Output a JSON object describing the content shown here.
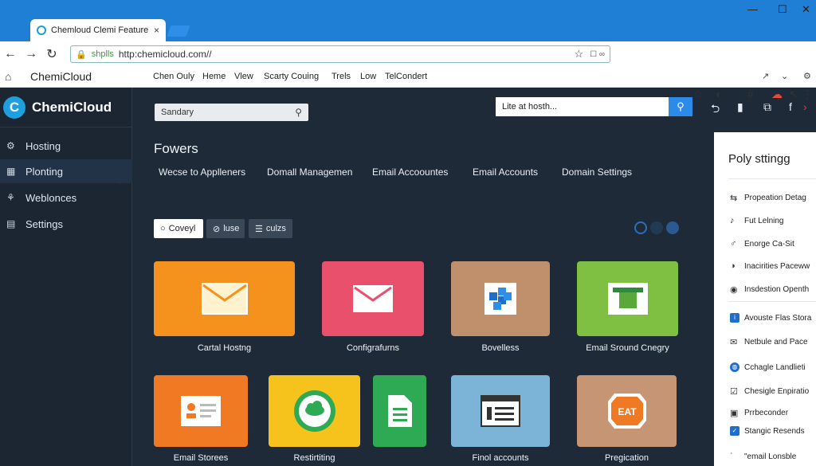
{
  "browser": {
    "tab_title": "Chemloud Clemi Feature",
    "tab_close": "×",
    "url_scheme": "shplls",
    "url": "http:chemicloud.com//",
    "url_extra": "☐ ∞"
  },
  "bookmarks": {
    "brand": "ChemiCloud",
    "items": [
      "Chen Ouly",
      "Heme",
      "Vlew",
      "Scarty Couing",
      "Trels",
      "Low",
      "TelCondert"
    ]
  },
  "sidebar": {
    "logo_letter": "C",
    "logo_text": "ChemiCloud",
    "items": [
      {
        "label": "Hosting",
        "icon": "⚙"
      },
      {
        "label": "Plonting",
        "icon": "▦"
      },
      {
        "label": "Weblonces",
        "icon": "⚘"
      },
      {
        "label": "Settings",
        "icon": "▤"
      }
    ]
  },
  "main": {
    "search_placeholder": "Sandary",
    "top_search_value": "Lite at hosth...",
    "section_title": "Fowers",
    "subtabs": [
      "Wecse to Applleners",
      "Domall Managemen",
      "Email Accoountes",
      "Email Accounts",
      "Domain Settings"
    ],
    "filters": [
      "Coveyl",
      "luse",
      "culzs"
    ],
    "cards": [
      {
        "label": "Cartal Hostng",
        "color": "#f5921e"
      },
      {
        "label": "Configrafurns",
        "color": "#e8506b"
      },
      {
        "label": "Bovelless",
        "color": "#c08f6c"
      },
      {
        "label": "Email Sround Cnegry",
        "color": "#7fbf41"
      },
      {
        "label": "Email Storees",
        "color": "#f07a24"
      },
      {
        "label": "Restirtiting",
        "color": "#f6c21c"
      },
      {
        "label": "",
        "color": "#2eaa55"
      },
      {
        "label": "Finol accounts",
        "color": "#7cb4d8"
      },
      {
        "label": "Pregication",
        "color": "#c69674"
      }
    ],
    "card_glyph_text": "EAT"
  },
  "right_panel": {
    "title": "Poly sttingg",
    "rows": [
      {
        "label": "Propeation Detag",
        "icon": "⇆"
      },
      {
        "label": "Fut Lelning",
        "icon": "♪"
      },
      {
        "label": "Enorge Ca-Sit",
        "icon": "♂"
      },
      {
        "label": "Inacirities Paceww",
        "icon": "◑"
      },
      {
        "label": "Insdestion Openth",
        "icon": "◉"
      },
      {
        "label": "Avouste Flas Stora",
        "icon": "i"
      },
      {
        "label": "Netbule and Pace",
        "icon": "✉"
      },
      {
        "label": "Cchagle Landlieti",
        "icon": "◍"
      },
      {
        "label": "Chesigle Enpiratio",
        "icon": "☑"
      },
      {
        "label": "Prrbeconder",
        "icon": "▣"
      },
      {
        "label": "Stangic Resends",
        "icon": "✓"
      },
      {
        "label": "\"email Lonsble",
        "icon": "ʿ"
      }
    ]
  },
  "colors": {
    "chrome_blue": "#1f7fd4",
    "app_bg": "#1e2a38",
    "sidebar_bg": "#1b2632",
    "accent": "#1ea0e0",
    "search_button": "#2c8be8"
  }
}
